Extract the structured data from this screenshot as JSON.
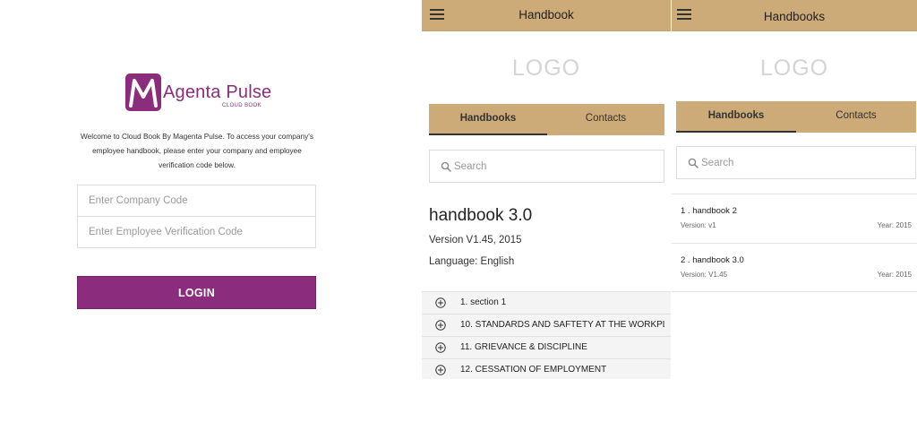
{
  "login": {
    "logo_initial": "M",
    "logo_text": "Agenta Pulse",
    "logo_sub": "CLOUD BOOK",
    "welcome_text": "Welcome to Cloud Book By Magenta Pulse. To access your company's employee handbook, please enter your company and employee verification code below.",
    "company_placeholder": "Enter Company Code",
    "employee_placeholder": "Enter Employee Verification Code",
    "login_label": "LOGIN",
    "brand_color": "#8b2d7c"
  },
  "handbook": {
    "title": "Handbook",
    "logo": "LOGO",
    "tabs": [
      {
        "label": "Handbooks",
        "active": true
      },
      {
        "label": "Contacts",
        "active": false
      }
    ],
    "search_placeholder": "Search",
    "name": "handbook 3.0",
    "version": "Version V1.45, 2015",
    "language": "Language: English",
    "sections": [
      {
        "label": "1. section 1",
        "icon": "plus-circle-icon"
      },
      {
        "label": "10. STANDARDS AND SAFTETY AT THE WORKPL...",
        "icon": "plus-circle-icon"
      },
      {
        "label": "11. GRIEVANCE & DISCIPLINE",
        "icon": "plus-circle-icon"
      },
      {
        "label": "12. CESSATION OF EMPLOYMENT",
        "icon": "plus-circle-icon"
      }
    ]
  },
  "handbooks": {
    "title": "Handbooks",
    "logo": "LOGO",
    "tabs": [
      {
        "label": "Handbooks",
        "active": true
      },
      {
        "label": "Contacts",
        "active": false
      }
    ],
    "search_placeholder": "Search",
    "items": [
      {
        "name": "1 . handbook 2",
        "version": "Version: v1",
        "year": "Year: 2015"
      },
      {
        "name": "2 . handbook 3.0",
        "version": "Version: V1.45",
        "year": "Year: 2015"
      }
    ]
  },
  "colors": {
    "accent": "#cdab79",
    "brand": "#8b2d7c",
    "section_bg": "#f4f4f4"
  }
}
